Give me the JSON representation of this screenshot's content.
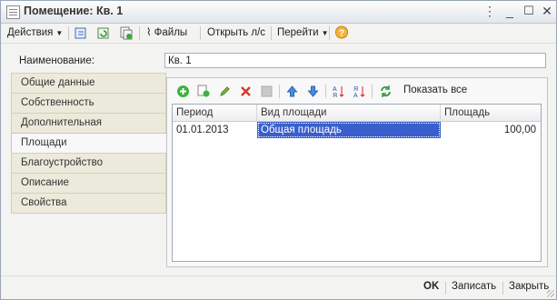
{
  "window": {
    "title": "Помещение: Кв. 1"
  },
  "toolbar": {
    "actions": "Действия",
    "files": "Файлы",
    "open_ls": "Открыть л/с",
    "goto": "Перейти",
    "help": "?"
  },
  "form": {
    "name_label": "Наименование:",
    "name_value": "Кв. 1"
  },
  "tabs": [
    {
      "label": "Общие данные"
    },
    {
      "label": "Собственность"
    },
    {
      "label": "Дополнительная информация"
    },
    {
      "label": "Площади"
    },
    {
      "label": "Благоустройство"
    },
    {
      "label": "Описание"
    },
    {
      "label": "Свойства"
    }
  ],
  "active_tab": "Площади",
  "panel_toolbar": {
    "show_all": "Показать все"
  },
  "table": {
    "columns": [
      "Период",
      "Вид площади",
      "Площадь"
    ],
    "rows": [
      {
        "period": "01.01.2013",
        "type": "Общая площадь",
        "area": "100,00"
      }
    ]
  },
  "footer": {
    "ok": "OK",
    "save": "Записать",
    "close": "Закрыть"
  },
  "colors": {
    "selection": "#3a5fcd",
    "help_icon": "#f0a21d"
  }
}
